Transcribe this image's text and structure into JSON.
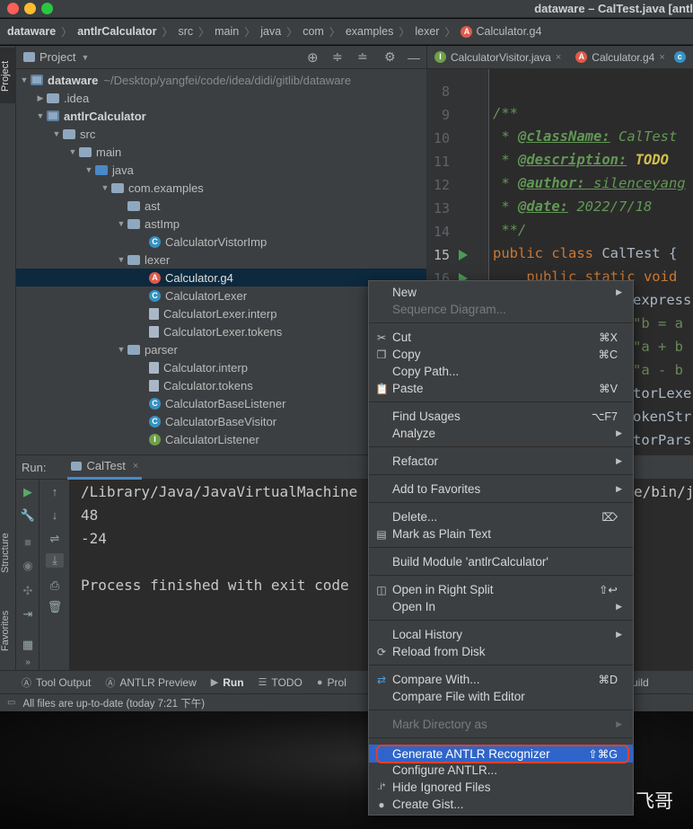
{
  "window": {
    "title": "dataware – CalTest.java [antl"
  },
  "breadcrumb": [
    "dataware",
    "antlrCalculator",
    "src",
    "main",
    "java",
    "com",
    "examples",
    "lexer",
    "Calculator.g4"
  ],
  "project_panel": {
    "title": "Project"
  },
  "tree": {
    "root_name": "dataware",
    "root_path": "~/Desktop/yangfei/code/idea/didi/gitlib/dataware",
    "idea": ".idea",
    "module": "antlrCalculator",
    "src": "src",
    "main": "main",
    "java": "java",
    "pkg": "com.examples",
    "ast": "ast",
    "astimp": "astImp",
    "visitor_imp": "CalculatorVistorImp",
    "lexer": "lexer",
    "calc_g4": "Calculator.g4",
    "calc_lexer": "CalculatorLexer",
    "calc_lexer_interp": "CalculatorLexer.interp",
    "calc_lexer_tokens": "CalculatorLexer.tokens",
    "parser": "parser",
    "calc_interp": "Calculator.interp",
    "calc_tokens": "Calculator.tokens",
    "base_listener": "CalculatorBaseListener",
    "base_visitor": "CalculatorBaseVisitor",
    "listener": "CalculatorListener"
  },
  "editor": {
    "tabs": [
      "CalculatorVisitor.java",
      "Calculator.g4"
    ],
    "line_numbers": [
      "8",
      "9",
      "10",
      "11",
      "12",
      "13",
      "14",
      "15",
      "16"
    ],
    "lines": {
      "l9": "/**",
      "l10_tag": "@className:",
      "l10_val": " CalTest",
      "l11_tag": "@description:",
      "l11_val": " TODO",
      "l12_tag": "@author:",
      "l12_val": " silenceyang",
      "l13_tag": "@date:",
      "l13_val": " 2022/7/18",
      "l14": " **/",
      "l15_kw": "public class",
      "l15_name": " CalTest {",
      "l16": "    public static void"
    }
  },
  "run": {
    "label": "Run:",
    "tab": "CalTest",
    "console": [
      "/Library/Java/JavaVirtualMachine",
      "48",
      "-24",
      "",
      "Process finished with exit code"
    ],
    "right_fragment": "e/bin/ja"
  },
  "bottom_tools": [
    "Tool Output",
    "ANTLR Preview",
    "Run",
    "TODO",
    "Prol",
    "uild"
  ],
  "status": "All files are up-to-date (today 7:21 下午)",
  "left_tabs": [
    "Project",
    "Structure",
    "Favorites"
  ],
  "code_right_fragments": [
    "express",
    "\"b = a",
    "\"a + b",
    "\"a - b",
    "torLexe",
    "okenStr",
    "torPars"
  ],
  "menu": {
    "new": "New",
    "seq": "Sequence Diagram...",
    "cut": "Cut",
    "cut_sc": "⌘X",
    "copy": "Copy",
    "copy_sc": "⌘C",
    "copy_path": "Copy Path...",
    "paste": "Paste",
    "paste_sc": "⌘V",
    "find_usages": "Find Usages",
    "find_sc": "⌥F7",
    "analyze": "Analyze",
    "refactor": "Refactor",
    "add_fav": "Add to Favorites",
    "delete": "Delete...",
    "mark_plain": "Mark as Plain Text",
    "build_module": "Build Module 'antlrCalculator'",
    "open_right": "Open in Right Split",
    "open_right_sc": "⇧↩",
    "open_in": "Open In",
    "local_history": "Local History",
    "reload": "Reload from Disk",
    "compare_with": "Compare With...",
    "compare_sc": "⌘D",
    "compare_editor": "Compare File with Editor",
    "mark_dir": "Mark Directory as",
    "generate": "Generate ANTLR Recognizer",
    "generate_sc": "⇧⌘G",
    "configure": "Configure ANTLR...",
    "hide_ignored": "Hide Ignored Files",
    "create_gist": "Create Gist..."
  },
  "watermark": "知乎 @飞哥"
}
